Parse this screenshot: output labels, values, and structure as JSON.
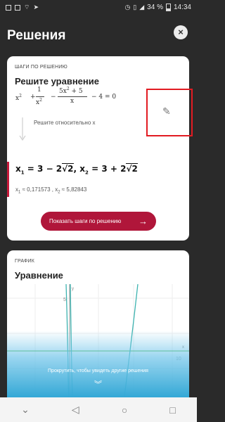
{
  "status": {
    "left_icons": [
      "mail-icon",
      "image-icon",
      "wifi-icon",
      "send-icon"
    ],
    "battery": "34 %",
    "time": "14:34"
  },
  "header": {
    "title": "Решения",
    "close_icon": "×"
  },
  "steps_card": {
    "section_label": "ШАГИ ПО РЕШЕНИЮ",
    "title": "Решите уравнение",
    "equation": {
      "x2": "x",
      "exp2": "2",
      "plus": "+",
      "num1": "1",
      "den1": "x",
      "den1_exp": "2",
      "minus1": "−",
      "num2": "5x",
      "num2_exp": "2",
      "num2_rest": " + 5",
      "den2": "x",
      "tail": "− 4 = 0"
    },
    "solve_for": "Решите относительно x",
    "answer": {
      "x1": "x",
      "x1_sub": "1",
      "x1_val": " = 3 − 2",
      "root1": "2",
      "sep": ", ",
      "x2": "x",
      "x2_sub": "2",
      "x2_val": " = 3 + 2",
      "root2": "2"
    },
    "approx": {
      "x1": "x",
      "x1_sub": "1",
      "x1_val": " ≈ 0,171573 , ",
      "x2": "x",
      "x2_sub": "2",
      "x2_val": " ≈ 5,82843"
    },
    "steps_button": "Показать шаги по решению"
  },
  "graph_card": {
    "section_label": "ГРАФИК",
    "title": "Уравнение",
    "y_tick": "5",
    "x_tick": "10",
    "y_axis_label": "y",
    "x_axis_label": "x",
    "colors": {
      "curve": "#3db3b0",
      "line": "#5cbf5a",
      "axis": "#9a9a9a"
    }
  },
  "bottom": {
    "scroll_hint": "Прокрутить, чтобы увидеть другие решения",
    "chevrons": "⌄"
  },
  "nav": {
    "back": "◁",
    "home": "○",
    "recent": "□",
    "hide": "⌄"
  }
}
